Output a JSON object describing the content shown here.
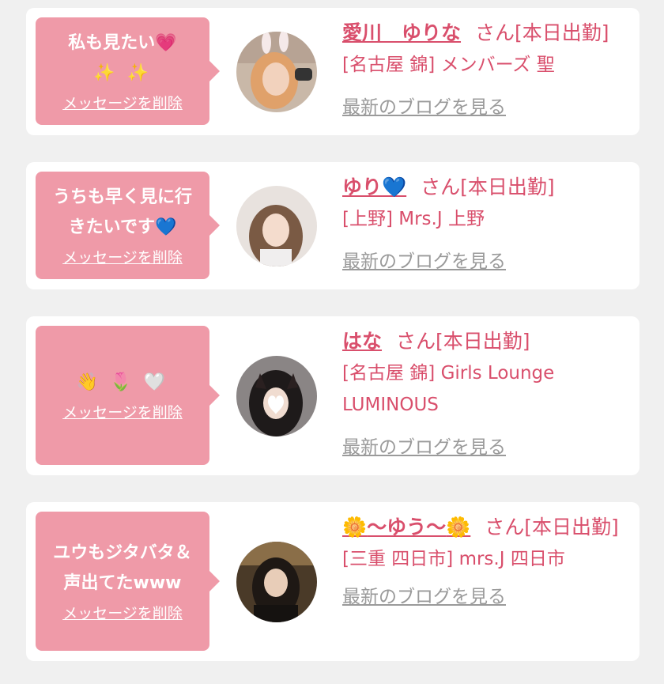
{
  "messages": [
    {
      "bubble_lines": [
        "私も見たい"
      ],
      "bubble_emoji_inline": "💗",
      "bubble_emoji_row": "✨ ✨",
      "delete_label": "メッセージを削除",
      "name": "愛川　ゆりな",
      "suffix": "さん[本日出勤]",
      "shop": "[名古屋 錦] メンバーズ 聖",
      "blog_label": "最新のブログを見る"
    },
    {
      "bubble_lines": [
        "うちも早く見に行",
        "きたいです"
      ],
      "bubble_emoji_inline": "💙",
      "delete_label": "メッセージを削除",
      "name": "ゆり",
      "name_emoji": "💙",
      "suffix": "さん[本日出勤]",
      "shop": "[上野] Mrs.J 上野",
      "blog_label": "最新のブログを見る"
    },
    {
      "bubble_emoji_row": "👋 🌷 🤍",
      "delete_label": "メッセージを削除",
      "name": "はな",
      "suffix": "さん[本日出勤]",
      "shop": "[名古屋 錦] Girls Lounge LUMINOUS",
      "blog_label": "最新のブログを見る"
    },
    {
      "bubble_lines": [
        "ユウもジタバタ＆",
        "声出てたwww"
      ],
      "delete_label": "メッセージを削除",
      "name": "〜ゆう〜",
      "name_emoji_left": "🌼",
      "name_emoji_right": "🌼",
      "suffix": "さん[本日出勤]",
      "shop": "[三重 四日市] mrs.J 四日市",
      "blog_label": "最新のブログを見る"
    }
  ],
  "colors": {
    "bubble": "#ef9aa8",
    "accent_text": "#d94f6c",
    "blog_link": "#9a9a9a",
    "background": "#f0f0f0"
  }
}
